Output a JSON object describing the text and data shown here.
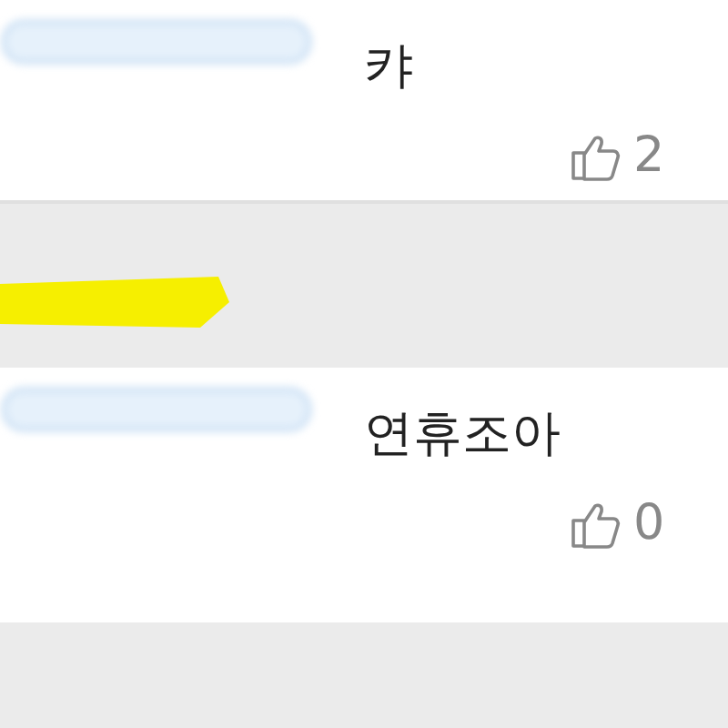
{
  "comments": [
    {
      "text": "캬",
      "likes": "2"
    },
    {
      "text": "연휴조아",
      "likes": "0"
    }
  ]
}
